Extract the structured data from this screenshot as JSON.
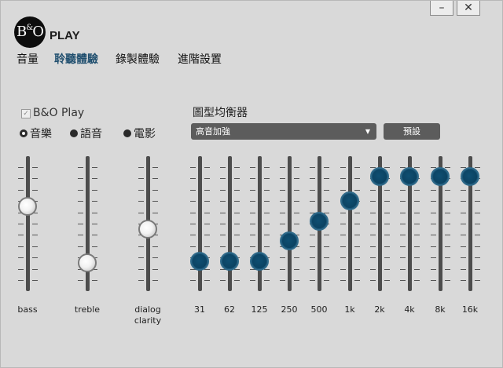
{
  "window": {
    "minimize_label": "–",
    "close_label": "✕"
  },
  "brand": {
    "logo_text": "B",
    "logo_amp": "&",
    "logo_text2": "O",
    "name": "PLAY"
  },
  "tabs": [
    "音量",
    "聆聽體驗",
    "錄製體驗",
    "進階設置"
  ],
  "active_tab": 1,
  "listening": {
    "checkbox_label": "B&O Play",
    "checkbox_checked": true,
    "modes": [
      {
        "label": "音樂",
        "selected": true
      },
      {
        "label": "語音",
        "selected": false
      },
      {
        "label": "電影",
        "selected": false
      }
    ],
    "tone_sliders": [
      {
        "label": "bass",
        "level": 0.65
      },
      {
        "label": "treble",
        "level": 0.15
      },
      {
        "label": "dialog\nclarity",
        "level": 0.45
      }
    ]
  },
  "equalizer": {
    "title": "圖型均衡器",
    "preset_value": "高音加強",
    "preset_button": "預設",
    "bands": [
      {
        "label": "31",
        "level": 0.17
      },
      {
        "label": "62",
        "level": 0.17
      },
      {
        "label": "125",
        "level": 0.17
      },
      {
        "label": "250",
        "level": 0.35
      },
      {
        "label": "500",
        "level": 0.52
      },
      {
        "label": "1k",
        "level": 0.7
      },
      {
        "label": "2k",
        "level": 0.92
      },
      {
        "label": "4k",
        "level": 0.92
      },
      {
        "label": "8k",
        "level": 0.92
      },
      {
        "label": "16k",
        "level": 0.92
      }
    ]
  },
  "colors": {
    "background": "#d9d9d9",
    "tab_active": "#1f4e6e",
    "eq_knob": "#0c4464",
    "track": "#4d4d4d"
  }
}
